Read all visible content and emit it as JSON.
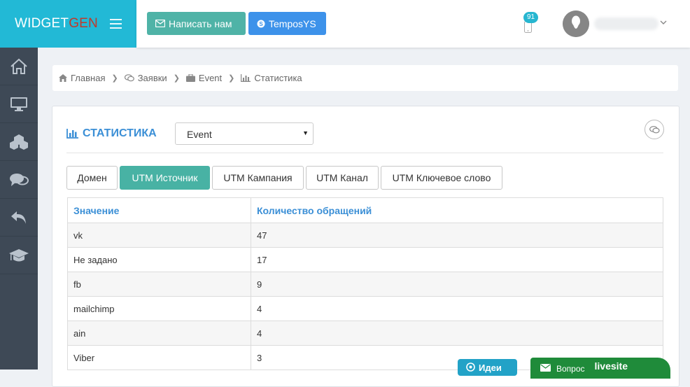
{
  "app": {
    "brand_main": "WIDGET",
    "brand_accent": "GEN"
  },
  "topbar": {
    "write_label": "Написать нам",
    "skype_label": "TemposYS",
    "notif_count": "91"
  },
  "breadcrumb": {
    "items": [
      "Главная",
      "Заявки",
      "Event",
      "Статистика"
    ]
  },
  "panel": {
    "title": "СТАТИСТИКА",
    "select_value": "Event"
  },
  "tabs": [
    "Домен",
    "UTM Источник",
    "UTM Кампания",
    "UTM Канал",
    "UTM Ключевое слово"
  ],
  "active_tab": "UTM Источник",
  "table": {
    "headers": [
      "Значение",
      "Количество обращений"
    ],
    "rows": [
      [
        "vk",
        "47"
      ],
      [
        "Не задано",
        "17"
      ],
      [
        "fb",
        "9"
      ],
      [
        "mailchimp",
        "4"
      ],
      [
        "ain",
        "4"
      ],
      [
        "Viber",
        "3"
      ]
    ]
  },
  "widgets": {
    "ideas": "Идеи",
    "question": "Вопрос",
    "question_brand": "livesite"
  },
  "colors": {
    "accent": "#22b9d6",
    "teal": "#48b2a4",
    "blue": "#3d92ea",
    "sidebar": "#3e4956",
    "link": "#3b8fd6"
  }
}
